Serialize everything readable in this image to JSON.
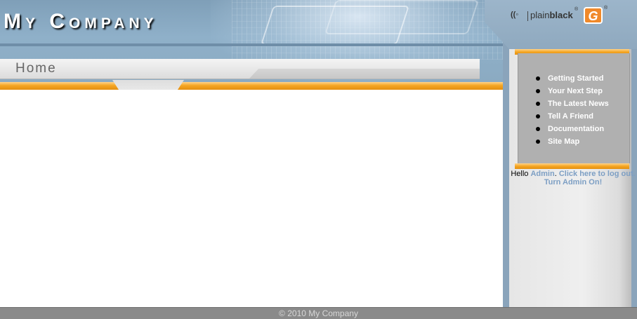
{
  "header": {
    "site_title": "My Company",
    "brand_name_plain": "plain",
    "brand_name_bold": "black",
    "brand_logo_letter": "G",
    "registered_mark": "®"
  },
  "nav": {
    "current_page": "Home"
  },
  "sidebar": {
    "menu_items": [
      {
        "label": "Getting Started"
      },
      {
        "label": "Your Next Step"
      },
      {
        "label": "The Latest News"
      },
      {
        "label": "Tell A Friend"
      },
      {
        "label": "Documentation"
      },
      {
        "label": "Site Map"
      }
    ],
    "greeting": "Hello",
    "user_name": "Admin",
    "separator": ".",
    "logout_link": "Click here to log out.",
    "admin_toggle": "Turn Admin On!"
  },
  "footer": {
    "copyright": "© 2010 My Company"
  },
  "colors": {
    "accent_orange": "#f5a623",
    "header_blue": "#8aa4bb",
    "link_blue": "#7d9fc4",
    "menu_gray": "#b0b0b0",
    "footer_gray": "#8a8a8a"
  }
}
